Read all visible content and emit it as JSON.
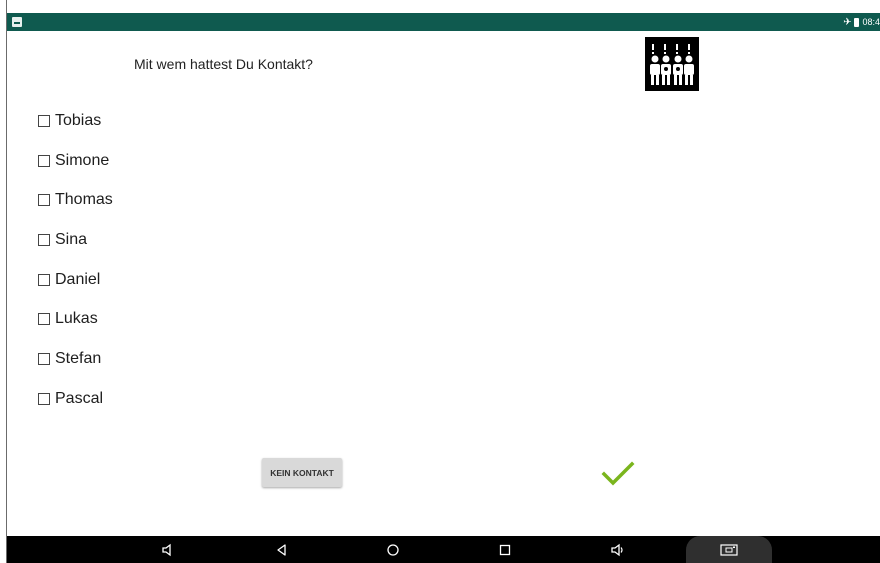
{
  "status_bar": {
    "time": "08:4",
    "icons": [
      "notification-icon",
      "airplane-mode-icon",
      "battery-icon"
    ],
    "color": "#0f5a4f"
  },
  "question": {
    "text": "Mit wem hattest Du Kontakt?"
  },
  "pictogram": {
    "icon": "group-people-icon"
  },
  "contacts": [
    {
      "label": "Tobias",
      "checked": false
    },
    {
      "label": "Simone",
      "checked": false
    },
    {
      "label": "Thomas",
      "checked": false
    },
    {
      "label": "Sina",
      "checked": false
    },
    {
      "label": "Daniel",
      "checked": false
    },
    {
      "label": "Lukas",
      "checked": false
    },
    {
      "label": "Stefan",
      "checked": false
    },
    {
      "label": "Pascal",
      "checked": false
    }
  ],
  "actions": {
    "no_contact_label": "KEIN KONTAKT",
    "confirm_icon": "checkmark-icon",
    "confirm_color": "#7ab51d"
  },
  "nav_bar": {
    "buttons": [
      "volume-down-icon",
      "back-icon",
      "home-icon",
      "recents-icon",
      "volume-up-icon",
      "screenshot-icon"
    ]
  }
}
